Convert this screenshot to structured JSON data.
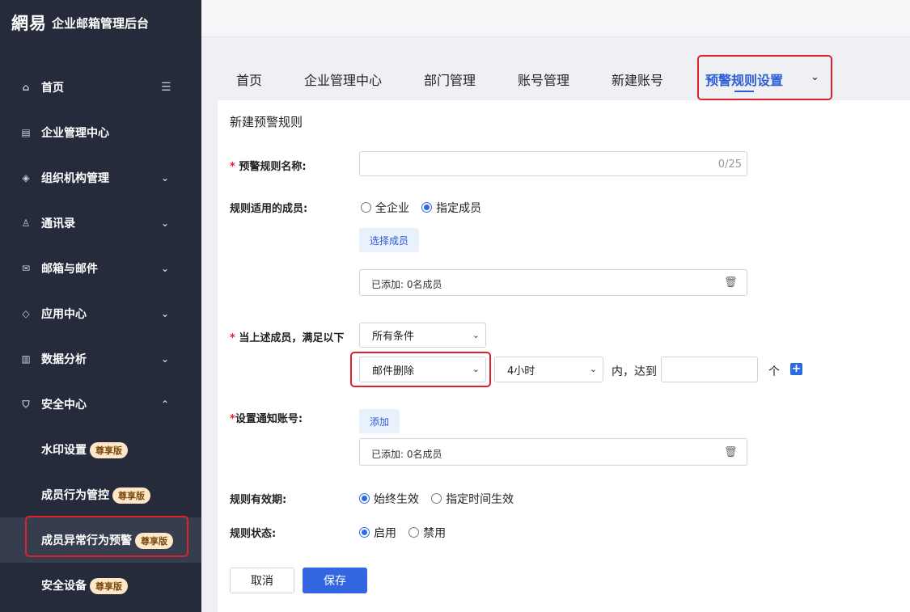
{
  "brand": {
    "logo": "網易",
    "title": "企业邮箱管理后台"
  },
  "sidebar": {
    "items": [
      {
        "label": "首页"
      },
      {
        "label": "企业管理中心"
      },
      {
        "label": "组织机构管理"
      },
      {
        "label": "通讯录"
      },
      {
        "label": "邮箱与邮件"
      },
      {
        "label": "应用中心"
      },
      {
        "label": "数据分析"
      },
      {
        "label": "安全中心"
      }
    ],
    "security_sub": [
      {
        "label": "水印设置",
        "badge": "尊享版"
      },
      {
        "label": "成员行为管控",
        "badge": "尊享版"
      },
      {
        "label": "成员异常行为预警",
        "badge": "尊享版"
      },
      {
        "label": "安全设备",
        "badge": "尊享版"
      }
    ]
  },
  "tabs": [
    {
      "label": "首页"
    },
    {
      "label": "企业管理中心"
    },
    {
      "label": "部门管理"
    },
    {
      "label": "账号管理"
    },
    {
      "label": "新建账号"
    },
    {
      "label": "预警规则设置"
    }
  ],
  "form": {
    "section_title": "新建预警规则",
    "name_label": "预警规则名称:",
    "name_counter": "0/25",
    "members_label": "规则适用的成员:",
    "radio_all": "全企业",
    "radio_specified": "指定成员",
    "select_members_btn": "选择成员",
    "added_members_text": "已添加: 0名成员",
    "condition_label": "当上述成员，满足以下",
    "condition_select": "所有条件",
    "event_select": "邮件删除",
    "period_select": "4小时",
    "within_text": "内，达到",
    "unit_text": "个",
    "notify_label": "设置通知账号:",
    "add_btn": "添加",
    "notify_added_text": "已添加: 0名成员",
    "validity_label": "规则有效期:",
    "validity_always": "始终生效",
    "validity_specified": "指定时间生效",
    "status_label": "规则状态:",
    "status_enable": "启用",
    "status_disable": "禁用",
    "cancel_btn": "取消",
    "save_btn": "保存"
  }
}
